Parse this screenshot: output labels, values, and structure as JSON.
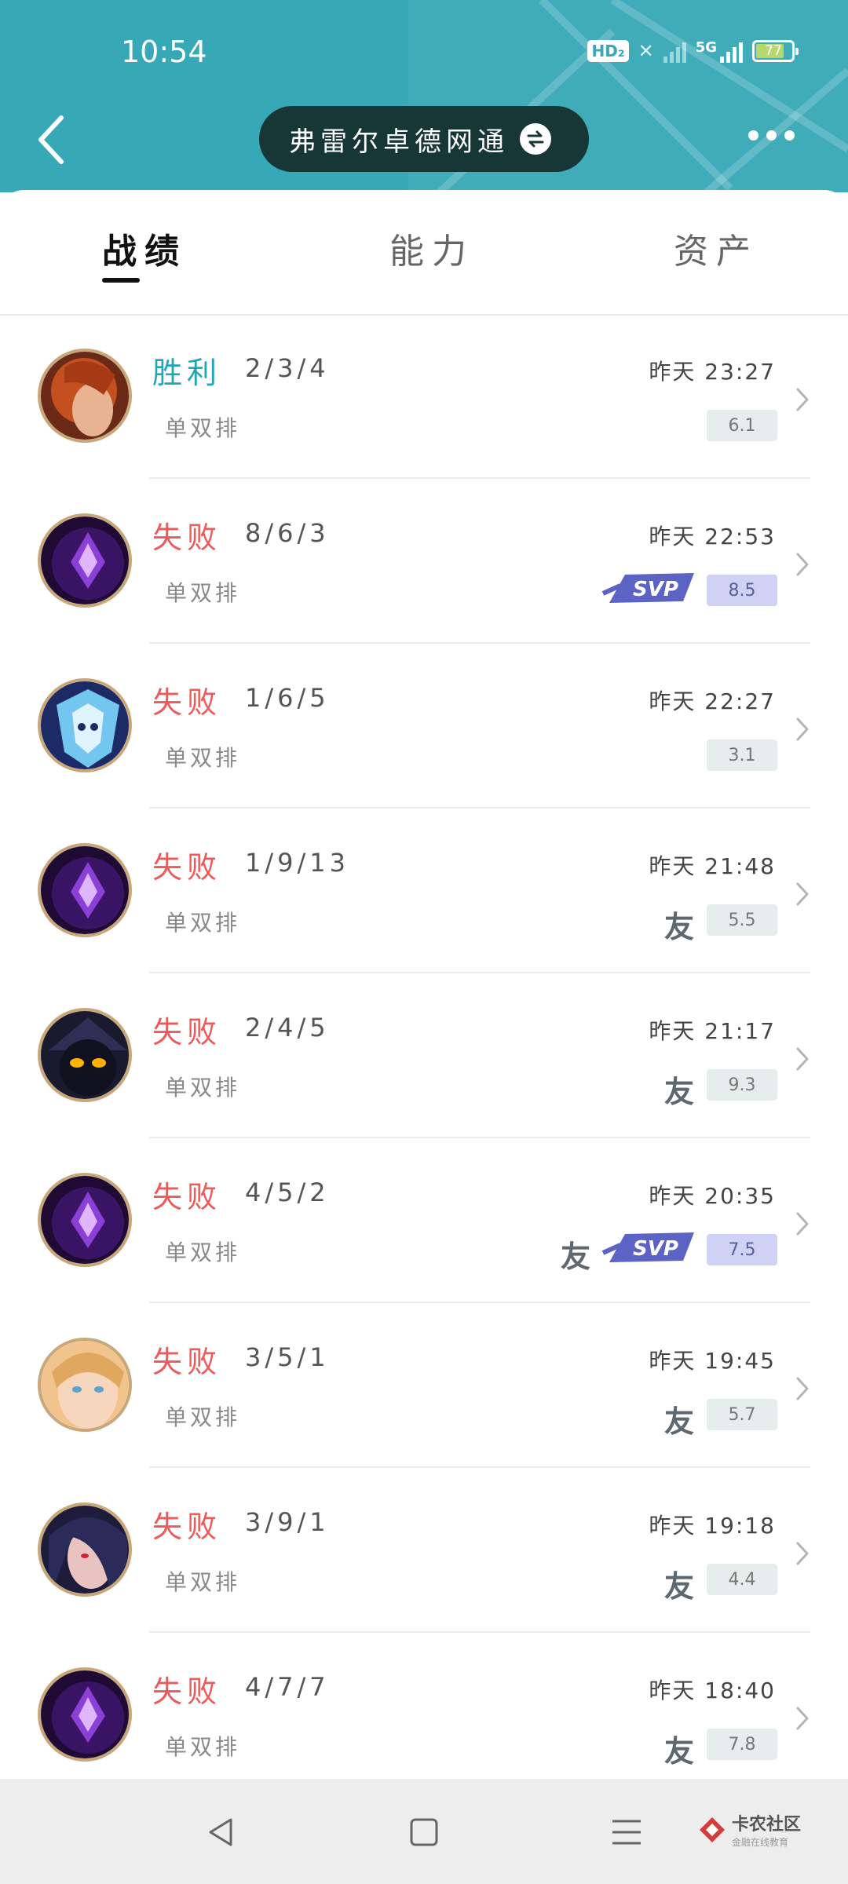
{
  "status": {
    "time": "10:54",
    "hd": "HD₂",
    "network": "5G",
    "battery": "77"
  },
  "header": {
    "account_name": "弗雷尔卓德网通"
  },
  "tabs": [
    {
      "label": "战绩",
      "active": true
    },
    {
      "label": "能力",
      "active": false
    },
    {
      "label": "资产",
      "active": false
    }
  ],
  "matches": [
    {
      "result": "胜利",
      "outcome": "win",
      "kda": "2/3/4",
      "mode": "单双排",
      "time": "昨天 23:27",
      "score": "6.1",
      "svp": false,
      "friend": ""
    },
    {
      "result": "失败",
      "outcome": "loss",
      "kda": "8/6/3",
      "mode": "单双排",
      "time": "昨天 22:53",
      "score": "8.5",
      "svp": true,
      "friend": ""
    },
    {
      "result": "失败",
      "outcome": "loss",
      "kda": "1/6/5",
      "mode": "单双排",
      "time": "昨天 22:27",
      "score": "3.1",
      "svp": false,
      "friend": ""
    },
    {
      "result": "失败",
      "outcome": "loss",
      "kda": "1/9/13",
      "mode": "单双排",
      "time": "昨天 21:48",
      "score": "5.5",
      "svp": false,
      "friend": "友"
    },
    {
      "result": "失败",
      "outcome": "loss",
      "kda": "2/4/5",
      "mode": "单双排",
      "time": "昨天 21:17",
      "score": "9.3",
      "svp": false,
      "friend": "友"
    },
    {
      "result": "失败",
      "outcome": "loss",
      "kda": "4/5/2",
      "mode": "单双排",
      "time": "昨天 20:35",
      "score": "7.5",
      "svp": true,
      "friend": "友"
    },
    {
      "result": "失败",
      "outcome": "loss",
      "kda": "3/5/1",
      "mode": "单双排",
      "time": "昨天 19:45",
      "score": "5.7",
      "svp": false,
      "friend": "友"
    },
    {
      "result": "失败",
      "outcome": "loss",
      "kda": "3/9/1",
      "mode": "单双排",
      "time": "昨天 19:18",
      "score": "4.4",
      "svp": false,
      "friend": "友"
    },
    {
      "result": "失败",
      "outcome": "loss",
      "kda": "4/7/7",
      "mode": "单双排",
      "time": "昨天 18:40",
      "score": "7.8",
      "svp": false,
      "friend": "友"
    }
  ],
  "watermark": {
    "main": "卡农社区",
    "sub": "金融在线教育"
  },
  "colors": {
    "header_bg": "#36a8b6",
    "win": "#22a5b5",
    "loss": "#ec5a5a",
    "mvp_score_bg": "#cfd2f4"
  },
  "icons": {
    "back": "chevron-left-icon",
    "swap": "swap-arrows-icon",
    "more": "more-dots-icon",
    "row_arrow": "chevron-right-icon"
  }
}
